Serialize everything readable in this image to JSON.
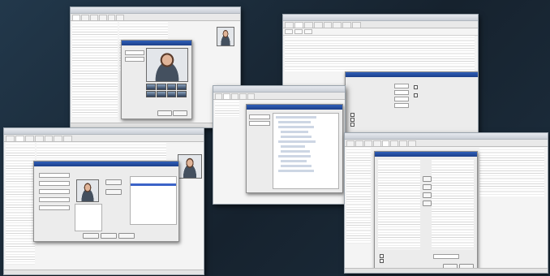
{
  "scene": {
    "background_color": "#1b2b3a",
    "window_count": 5
  },
  "windows": [
    {
      "id": "photo-manager-window",
      "contents": [
        "user list table",
        "camera capture dialog",
        "photo preview",
        "thumbnail grid"
      ]
    },
    {
      "id": "options-window",
      "contents": [
        "tabbed property grid",
        "settings dialog"
      ]
    },
    {
      "id": "tree-window",
      "contents": [
        "access tree dialog"
      ]
    },
    {
      "id": "employee-window",
      "contents": [
        "user list",
        "employee detail dialog",
        "portrait photo"
      ]
    },
    {
      "id": "access-level-window",
      "contents": [
        "access table",
        "assignment dialog"
      ]
    }
  ],
  "icons": [
    "window-icon",
    "photo-icon",
    "tree-node-icon",
    "checkbox-icon"
  ]
}
